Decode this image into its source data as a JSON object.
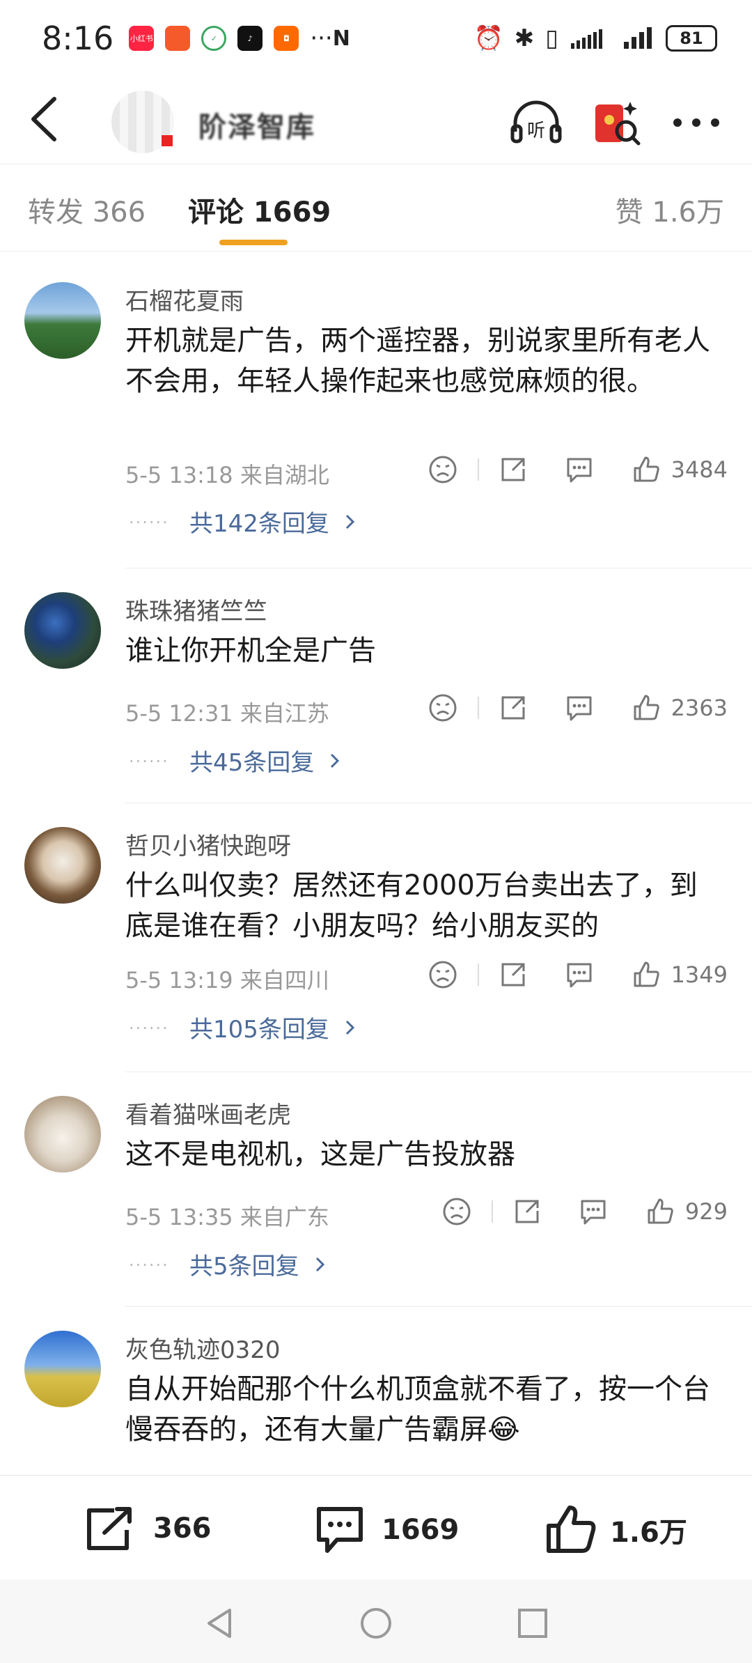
{
  "status_bar": {
    "time": "8:16",
    "app_icons": [
      {
        "name": "xiaohongshu-icon",
        "label": "小红书",
        "color": "#ff2442"
      },
      {
        "name": "app-orange-icon",
        "label": "",
        "color": "#f55a2a"
      },
      {
        "name": "app-green-icon",
        "label": "",
        "color": "#3aa760"
      },
      {
        "name": "tiktok-icon",
        "label": "",
        "color": "#111111"
      },
      {
        "name": "app-taobao-icon",
        "label": "",
        "color": "#ff6a00"
      }
    ],
    "more": "···",
    "battery": "81"
  },
  "header": {
    "title": "阶泽智库"
  },
  "tabs": {
    "repost": "转发 366",
    "comments": "评论 1669",
    "likes": "赞 1.6万"
  },
  "comments": [
    {
      "user": "石榴花夏雨",
      "text": "开机就是广告，两个遥控器，别说家里所有老人不会用，年轻人操作起来也感觉麻烦的很。",
      "meta": "5-5 13:18 来自湖北",
      "likes": "3484",
      "replies": "共142条回复"
    },
    {
      "user": "珠珠猪猪竺竺",
      "text": "谁让你开机全是广告",
      "meta": "5-5 12:31 来自江苏",
      "likes": "2363",
      "replies": "共45条回复"
    },
    {
      "user": "哲贝小猪快跑呀",
      "text": "什么叫仅卖？居然还有2000万台卖出去了，到底是谁在看？小朋友吗？给小朋友买的",
      "meta": "5-5 13:19 来自四川",
      "likes": "1349",
      "replies": "共105条回复"
    },
    {
      "user": "看着猫咪画老虎",
      "text": "这不是电视机，这是广告投放器",
      "meta": "5-5 13:35 来自广东",
      "likes": "929",
      "replies": "共5条回复"
    },
    {
      "user": "灰色轨迹0320",
      "text": "自从开始配那个什么机顶盒就不看了，按一个台慢吞吞的，还有大量广告霸屏😂",
      "meta": "",
      "likes": "",
      "replies": ""
    }
  ],
  "bottom_bar": {
    "reposts": "366",
    "comments": "1669",
    "likes": "1.6万"
  },
  "colors": {
    "accent": "#f0a020",
    "link": "#4a6a9a"
  }
}
